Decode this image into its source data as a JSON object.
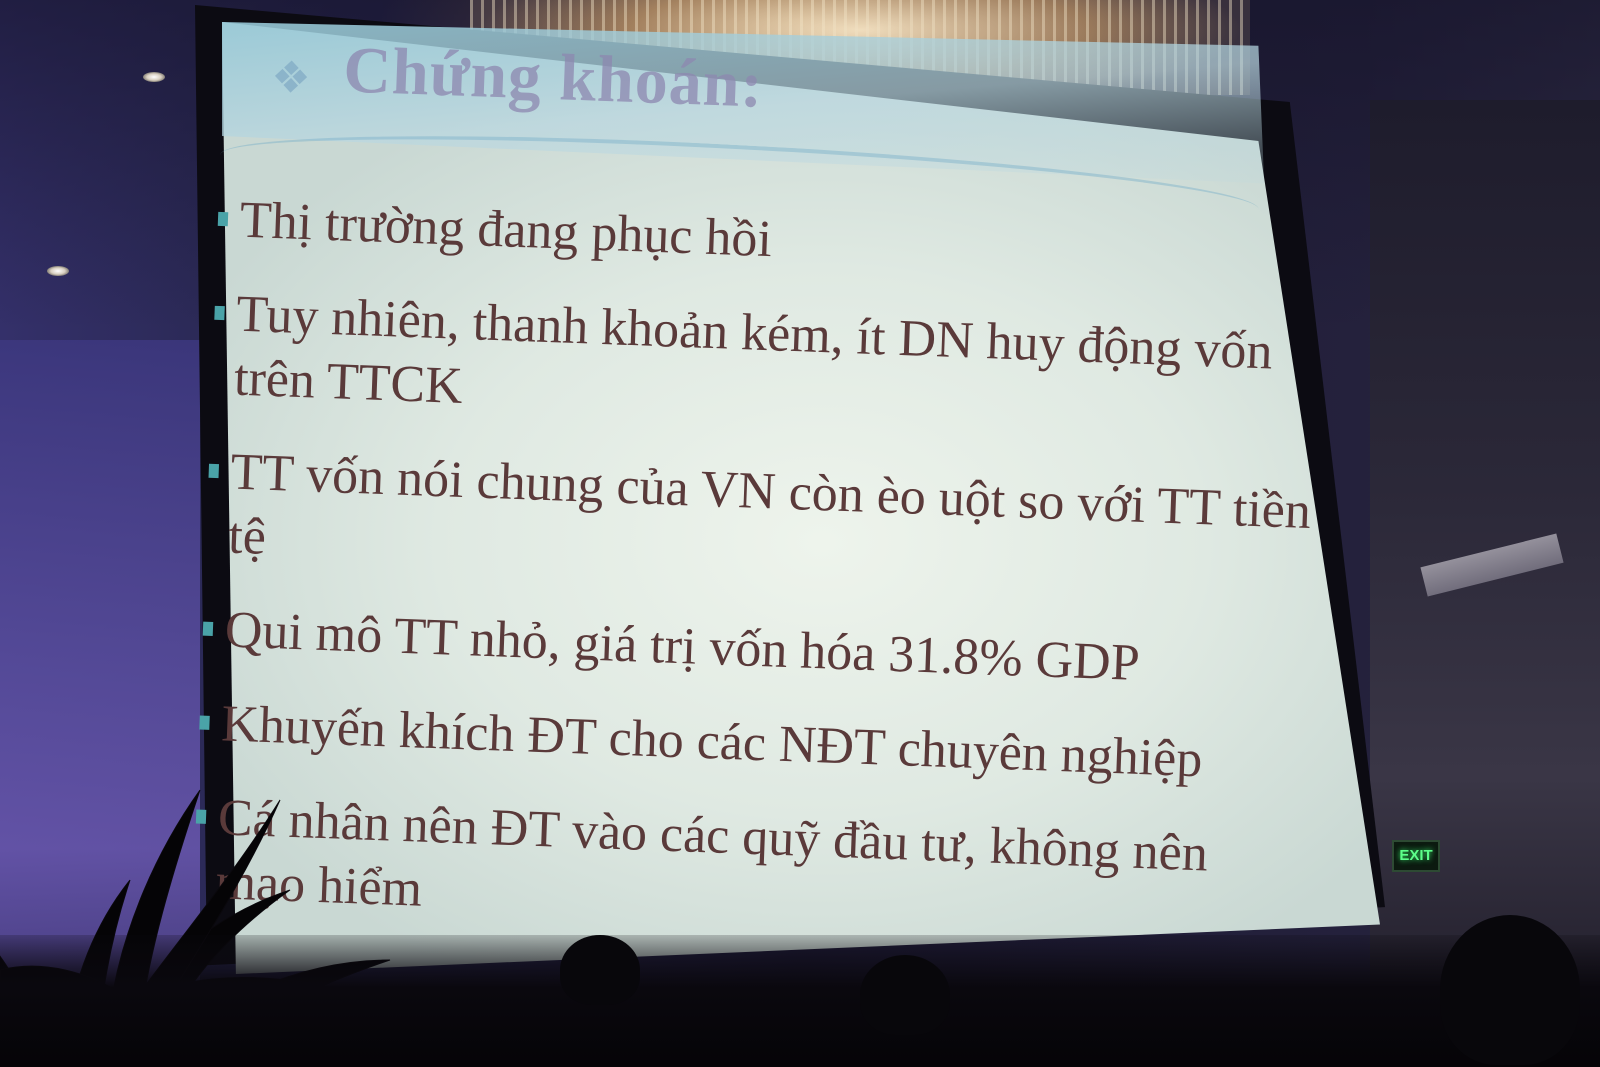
{
  "slide": {
    "title": "Chứng khoán:",
    "bullets": [
      "Thị trường đang phục hồi",
      "Tuy nhiên, thanh khoản kém, ít DN huy động vốn trên TTCK",
      "TT vốn nói chung của VN còn èo uột so với TT tiền tệ",
      "Qui mô TT nhỏ, giá trị vốn hóa 31.8% GDP",
      "Khuyến khích ĐT cho các NĐT chuyên nghiệp",
      "Cá nhân nên ĐT vào các quỹ đầu tư, không nên mạo hiểm"
    ]
  },
  "room": {
    "exit_sign": "EXIT"
  },
  "colors": {
    "slide_background": "#e2ece6",
    "bullet_text": "#5a3a3a",
    "title_text": "#8d88b0",
    "bullet_marker": "#4aa3a8",
    "exit_glow": "#5dff8a"
  }
}
